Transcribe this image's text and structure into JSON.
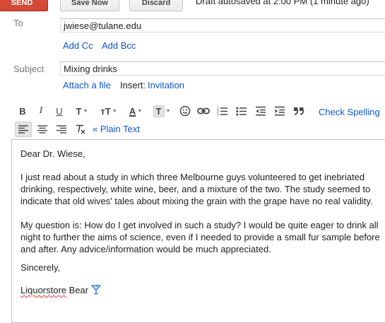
{
  "actions": {
    "send": "SEND",
    "save_now": "Save Now",
    "discard": "Discard",
    "autosave_status": "Draft autosaved at 2:00 PM (1 minute ago)"
  },
  "header": {
    "to_label": "To",
    "to_value": "jwiese@tulane.edu",
    "add_cc": "Add Cc",
    "add_bcc": "Add Bcc",
    "subject_label": "Subject",
    "subject_value": "Mixing drinks",
    "attach_file": "Attach a file",
    "insert_label": "Insert:",
    "invitation": "Invitation"
  },
  "toolbar": {
    "bold": "B",
    "italic": "I",
    "underline": "U",
    "font": "T",
    "size": "тT",
    "text_color": "A",
    "highlight": "T",
    "check_spelling": "Check Spelling",
    "plain_text": "« Plain Text"
  },
  "message": {
    "greeting": "Dear Dr. Wiese,",
    "para1": "I just read about a study in which three Melbourne guys volunteered to get inebriated drinking, respectively, white wine, beer, and a mixture of the two. The study seemed to indicate that old wives' tales about mixing the grain with the grape have no real validity.",
    "para2": "My question is: How do I get involved in such a study? I would be quite eager to drink all night to further the aims of science, even if I needed to provide a small fur sample before and after. Any advice/information would be much appreciated.",
    "closing": "Sincerely,",
    "sig_name": "Liquorstore",
    "sig_last": " Bear"
  },
  "colors": {
    "send_bg": "#d14836",
    "link": "#1155cc",
    "label": "#777777",
    "spell_error": "#e03030",
    "glass_icon": "#2a7bd4"
  },
  "icons": {
    "emoji": "smiley-icon",
    "link": "link-icon",
    "numbered_list": "numbered-list-icon",
    "bullet_list": "bullet-list-icon",
    "indent_less": "indent-less-icon",
    "indent_more": "indent-more-icon",
    "quote": "quote-icon",
    "align_left": "align-left-icon",
    "align_center": "align-center-icon",
    "align_right": "align-right-icon",
    "remove_format": "remove-formatting-icon",
    "signature_glass": "cocktail-glass-icon"
  }
}
